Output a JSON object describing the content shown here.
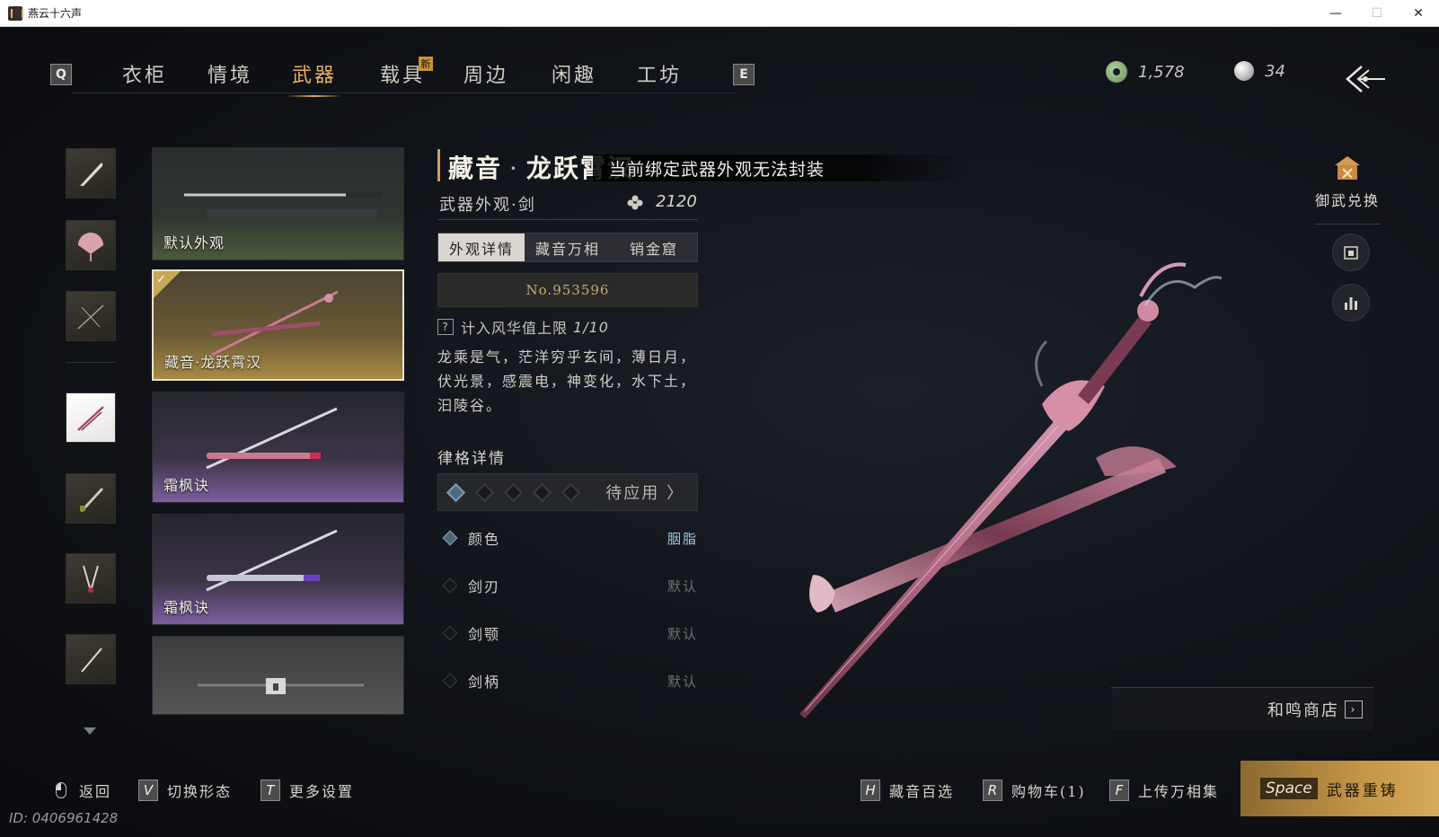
{
  "window": {
    "title": "燕云十六声",
    "minimize": "—",
    "maximize": "☐",
    "close": "✕"
  },
  "top_nav": {
    "left_key": "Q",
    "right_key": "E",
    "tabs": [
      "衣柜",
      "情境",
      "武器",
      "载具",
      "周边",
      "闲趣",
      "工坊"
    ],
    "active_tab": "武器",
    "new_badge": "新"
  },
  "currency": {
    "jade": "1,578",
    "pearl": "34"
  },
  "skin_cards": [
    {
      "label": "默认外观"
    },
    {
      "label": "藏音·龙跃霄汉",
      "selected": true
    },
    {
      "label": "霜枫诀"
    },
    {
      "label": "霜枫诀"
    },
    {
      "label": ""
    }
  ],
  "detail": {
    "title_part1": "藏音",
    "title_sep": "·",
    "title_part2": "龙跃霄汉",
    "toast": "当前绑定武器外观无法封装",
    "subtitle": "武器外观·剑",
    "score": "2120",
    "segments": [
      "外观详情",
      "藏音万相",
      "销金窟"
    ],
    "active_segment": "外观详情",
    "serial": "No.953596",
    "fenghua_label": "计入风华值上限",
    "fenghua_value": "1/10",
    "description": "龙乘是气，茫洋穷乎玄间，薄日月，伏光景，感震电，神变化，水下土，汩陵谷。",
    "lvge_title": "律格详情",
    "lvge_pending": "待应用 〉",
    "properties": [
      {
        "name": "颜色",
        "value": "胭脂",
        "active": true
      },
      {
        "name": "剑刃",
        "value": "默认",
        "active": false
      },
      {
        "name": "剑颚",
        "value": "默认",
        "active": false
      },
      {
        "name": "剑柄",
        "value": "默认",
        "active": false
      }
    ]
  },
  "right_panel": {
    "exchange_label": "御武兑换",
    "shop_label": "和鸣商店"
  },
  "bottom_hints": {
    "back": "返回",
    "switch_key": "V",
    "switch_label": "切换形态",
    "more_key": "T",
    "more_label": "更多设置",
    "cang_key": "H",
    "cang_label": "藏音百选",
    "cart_key": "R",
    "cart_label": "购物车(1)",
    "upload_key": "F",
    "upload_label": "上传万相集",
    "recast_key": "Space",
    "recast_label": "武器重铸"
  },
  "user_id": "ID: 0406961428",
  "colors": {
    "accent_gold": "#e4b25a",
    "recast_gold": "#c49447",
    "blue_value": "#9cc3e0",
    "weapon_pink": "#c77a93"
  }
}
